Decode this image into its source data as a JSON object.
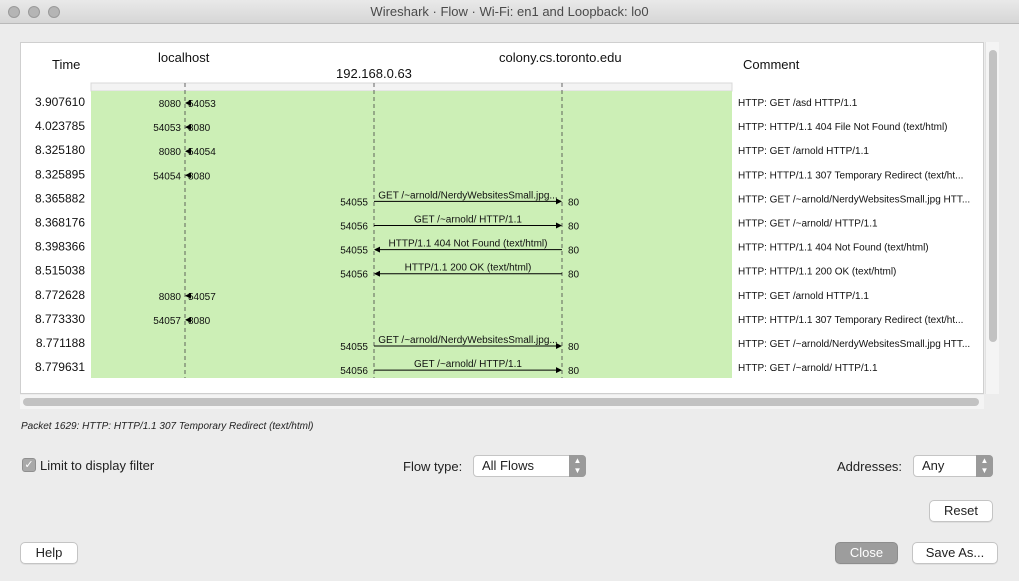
{
  "window": {
    "title": "Wireshark · Flow · Wi-Fi: en1 and Loopback: lo0"
  },
  "headers": {
    "time": "Time",
    "localhost": "localhost",
    "remote_host": "colony.cs.toronto.edu",
    "middle_host": "192.168.0.63",
    "comment": "Comment"
  },
  "rows": [
    {
      "time": "3.907610",
      "from_port": "8080",
      "to_port": "54053",
      "label": "",
      "comment": "HTTP: GET /asd HTTP/1.1"
    },
    {
      "time": "4.023785",
      "from_port": "54053",
      "to_port": "8080",
      "label": "",
      "comment": "HTTP: HTTP/1.1 404 File Not Found  (text/html)"
    },
    {
      "time": "8.325180",
      "from_port": "8080",
      "to_port": "54054",
      "label": "",
      "comment": "HTTP: GET /arnold HTTP/1.1"
    },
    {
      "time": "8.325895",
      "from_port": "54054",
      "to_port": "8080",
      "label": "",
      "comment": "HTTP: HTTP/1.1 307 Temporary Redirect  (text/ht..."
    },
    {
      "time": "8.365882",
      "from_port": "54055",
      "to_port": "80",
      "label": "GET /~arnold/NerdyWebsitesSmall.jpg...",
      "comment": "HTTP: GET /~arnold/NerdyWebsitesSmall.jpg HTT..."
    },
    {
      "time": "8.368176",
      "from_port": "54056",
      "to_port": "80",
      "label": "GET /~arnold/ HTTP/1.1",
      "comment": "HTTP: GET /~arnold/ HTTP/1.1"
    },
    {
      "time": "8.398366",
      "from_port": "54055",
      "to_port": "80",
      "label": "HTTP/1.1 404 Not Found  (text/html)",
      "comment": "HTTP: HTTP/1.1 404 Not Found  (text/html)"
    },
    {
      "time": "8.515038",
      "from_port": "54056",
      "to_port": "80",
      "label": "HTTP/1.1 200 OK  (text/html)",
      "comment": "HTTP: HTTP/1.1 200 OK  (text/html)"
    },
    {
      "time": "8.772628",
      "from_port": "8080",
      "to_port": "54057",
      "label": "",
      "comment": "HTTP: GET /arnold HTTP/1.1"
    },
    {
      "time": "8.773330",
      "from_port": "54057",
      "to_port": "8080",
      "label": "",
      "comment": "HTTP: HTTP/1.1 307 Temporary Redirect  (text/ht..."
    },
    {
      "time": "8.771188",
      "from_port": "54055",
      "to_port": "80",
      "label": "GET /~arnold/NerdyWebsitesSmall.jpg...",
      "comment": "HTTP: GET /~arnold/NerdyWebsitesSmall.jpg HTT..."
    },
    {
      "time": "8.779631",
      "from_port": "54056",
      "to_port": "80",
      "label": "GET /~arnold/ HTTP/1.1",
      "comment": "HTTP: GET /~arnold/ HTTP/1.1"
    }
  ],
  "status": {
    "packet_info": "Packet 1629: HTTP: HTTP/1.1 307 Temporary Redirect (text/html)"
  },
  "controls": {
    "limit_filter_label": "Limit to display filter",
    "limit_filter_checked": true,
    "flow_type_label": "Flow type:",
    "flow_type_value": "All Flows",
    "addresses_label": "Addresses:",
    "addresses_value": "Any"
  },
  "buttons": {
    "reset": "Reset",
    "help": "Help",
    "close": "Close",
    "save_as": "Save As..."
  },
  "colors": {
    "flow_bg": "#ccefb6",
    "panel_bg": "#ffffff"
  }
}
